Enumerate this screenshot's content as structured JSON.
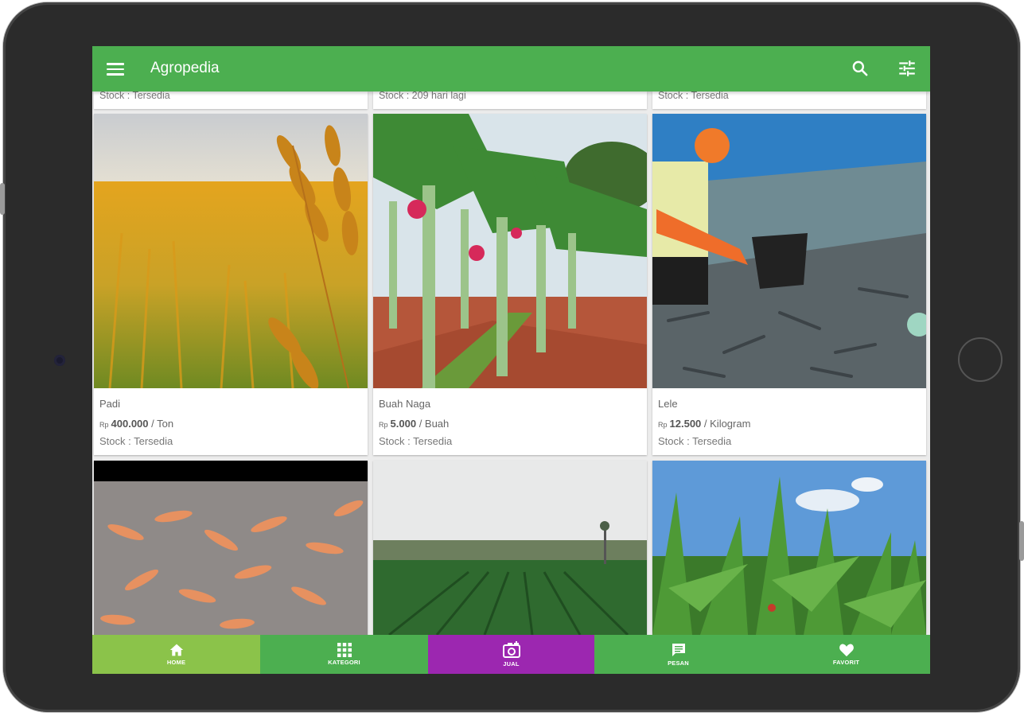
{
  "app": {
    "title": "Agropedia"
  },
  "colors": {
    "primary": "#4caf50",
    "home_active": "#8bc34a",
    "sell": "#9c27b0",
    "nav": "#4caf50"
  },
  "icons": {
    "menu": "menu-icon",
    "search": "search-icon",
    "filter": "tune-icon"
  },
  "top_partial_row": [
    {
      "stock": "Stock : Tersedia"
    },
    {
      "stock": "Stock : 209 hari lagi"
    },
    {
      "stock": "Stock : Tersedia"
    }
  ],
  "products": [
    {
      "name": "Padi",
      "currency": "Rp",
      "price": "400.000",
      "unit": "/ Ton",
      "stock": "Stock : Tersedia",
      "image": "rice-field"
    },
    {
      "name": "Buah Naga",
      "currency": "Rp",
      "price": "5.000",
      "unit": "/ Buah",
      "stock": "Stock : Tersedia",
      "image": "dragon-fruit-farm"
    },
    {
      "name": "Lele",
      "currency": "Rp",
      "price": "12.500",
      "unit": "/ Kilogram",
      "stock": "Stock : Tersedia",
      "image": "catfish-pond"
    }
  ],
  "products_partial": [
    {
      "image": "shrimp-pond"
    },
    {
      "image": "cabbage-field"
    },
    {
      "image": "corn-field"
    }
  ],
  "bottom_nav": [
    {
      "label": "HOME",
      "icon": "home-icon",
      "active": true
    },
    {
      "label": "KATEGORI",
      "icon": "grid-icon",
      "active": false
    },
    {
      "label": "JUAL",
      "icon": "camera-plus-icon",
      "active": false
    },
    {
      "label": "PESAN",
      "icon": "message-icon",
      "active": false
    },
    {
      "label": "FAVORIT",
      "icon": "heart-icon",
      "active": false
    }
  ]
}
